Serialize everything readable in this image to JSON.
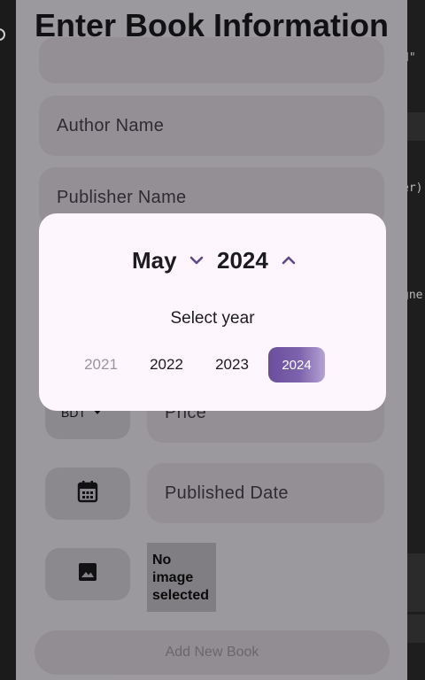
{
  "app": {
    "title": "Enter Book Information",
    "fields": {
      "author_placeholder": "Author Name",
      "publisher_placeholder": "Publisher Name",
      "price_placeholder": "Price",
      "published_date_placeholder": "Published Date"
    },
    "currency_label": "BDT",
    "no_image_text": "No image selected",
    "add_button_label": "Add New Book"
  },
  "date_picker": {
    "month": "May",
    "year": "2024",
    "select_year_label": "Select year",
    "years": [
      {
        "label": "2021",
        "state": "faded"
      },
      {
        "label": "2022",
        "state": "normal"
      },
      {
        "label": "2023",
        "state": "normal"
      },
      {
        "label": "2024",
        "state": "selected"
      }
    ]
  },
  "editor_fragments": [
    "d\"",
    "er)",
    "gne"
  ],
  "colors": {
    "accent": "#6a4d9f",
    "dialog_bg": "#fdf6fc",
    "field_bg": "#e6e0e9"
  }
}
